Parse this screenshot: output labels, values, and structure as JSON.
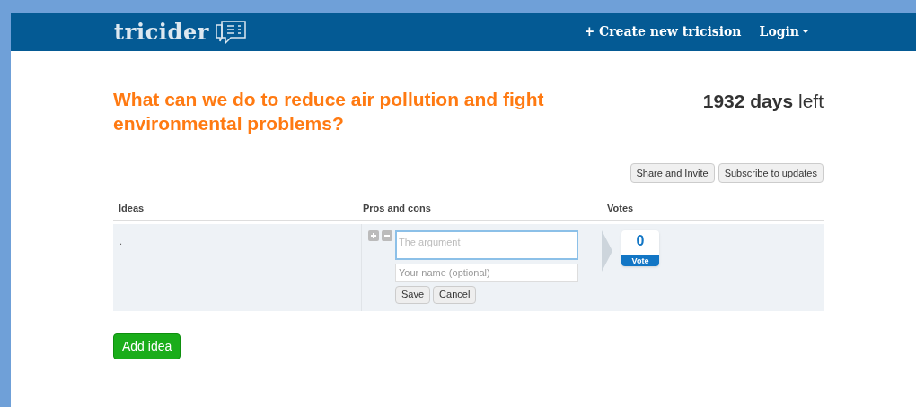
{
  "header": {
    "logo": "tricider",
    "nav": [
      {
        "label": "+ Create new tricision",
        "kind": "link"
      },
      {
        "label": "Login",
        "kind": "menu"
      }
    ]
  },
  "question": "What can we do to reduce air pollution and fight environmental problems?",
  "countdown": {
    "number": "1932",
    "unit": "days",
    "suffix": "left"
  },
  "actions": [
    "Share and Invite",
    "Subscribe to updates"
  ],
  "table": {
    "columns": [
      "Ideas",
      "Pros and cons",
      "Votes"
    ],
    "rows": [
      {
        "idea": ".",
        "argument_placeholder": "The argument",
        "name_placeholder": "Your name (optional)",
        "form_buttons": [
          "Save",
          "Cancel"
        ],
        "votes": "0",
        "vote_label": "Vote"
      }
    ]
  },
  "add_button": "Add idea"
}
